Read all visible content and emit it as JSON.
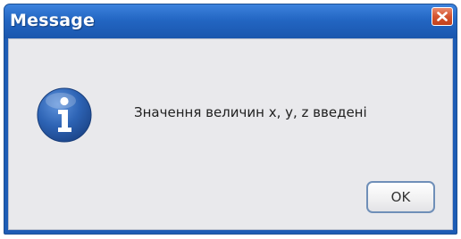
{
  "window": {
    "title": "Message",
    "close_icon": "close-icon"
  },
  "dialog": {
    "icon": "info-icon",
    "message": "Значення величин x, y, z введені",
    "ok_label": "OK"
  },
  "colors": {
    "titlebar": "#2366c3",
    "client_bg": "#e9e9ec",
    "close_button": "#d4532e",
    "info_icon": "#2d63b4"
  }
}
